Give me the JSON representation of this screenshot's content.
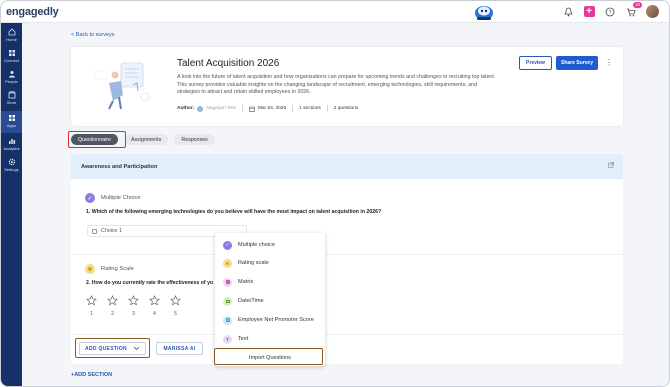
{
  "app": {
    "logo": "engagedly",
    "notification_count": "10"
  },
  "sidebar": {
    "items": [
      {
        "label": "Home",
        "icon": "home-icon"
      },
      {
        "label": "Connect",
        "icon": "connect-icon"
      },
      {
        "label": "People",
        "icon": "people-icon"
      },
      {
        "label": "Store",
        "icon": "store-icon"
      },
      {
        "label": "Apps",
        "icon": "apps-icon",
        "active": true
      },
      {
        "label": "Analytics",
        "icon": "analytics-icon"
      },
      {
        "label": "Settings",
        "icon": "settings-icon"
      }
    ]
  },
  "nav": {
    "back_link": "< Back to surveys"
  },
  "survey": {
    "title": "Talent Acquisition 2026",
    "description": "A look into the future of talent acquisition and how organizations can prepare for upcoming trends and challenges in recruiting top talent. This survey provides valuable insights on the changing landscape of recruitment, emerging technologies, skill requirements, and strategies to attract and retain skilled employees in 2026.",
    "author_label": "Author:",
    "author_name": "Nagarjan Test",
    "date": "Mar 03, 2026",
    "sections": "1 sections",
    "questions": "2 questions",
    "preview_label": "Preview",
    "share_label": "Share Survey"
  },
  "tabs": [
    {
      "label": "Questionnaire",
      "active": true
    },
    {
      "label": "Assignments"
    },
    {
      "label": "Responses"
    }
  ],
  "section": {
    "title": "Awareness and Participation",
    "q1": {
      "type": "Multiple Choice",
      "text": "1. Which of the following emerging technologies do you believe will have the most impact on talent acquisition in 2026?",
      "option": "Choice 1"
    },
    "q2": {
      "type": "Rating Scale",
      "text": "2. How do you currently rate the effectiveness of yo",
      "scale": [
        "1",
        "2",
        "3",
        "4",
        "5"
      ]
    },
    "add_question_label": "ADD QUESTION",
    "marissa_label": "MARISSA AI"
  },
  "add_section_label": "+ADD SECTION",
  "dropdown": {
    "items": [
      {
        "label": "Multiple choice",
        "color": "#8e7be0"
      },
      {
        "label": "Rating scale",
        "color": "#e8c34a"
      },
      {
        "label": "Matrix",
        "color": "#d98ad0"
      },
      {
        "label": "Date/Time",
        "color": "#8cc152"
      },
      {
        "label": "Employee Net Promoter Score",
        "color": "#4aa6e0"
      },
      {
        "label": "Text",
        "color": "#9b6fd6"
      }
    ],
    "import_label": "Import Questions"
  },
  "colors": {
    "primary": "#1f5cd1",
    "sidebar": "#16306a",
    "highlight_red": "#d9322b",
    "highlight_brown": "#8a5a20"
  }
}
